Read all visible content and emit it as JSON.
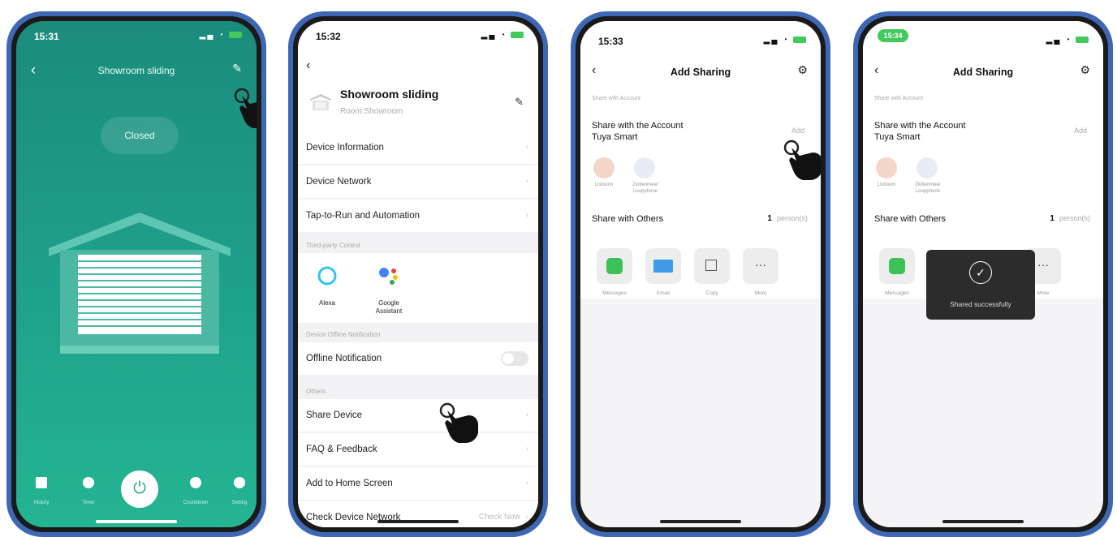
{
  "screen1": {
    "time": "15:31",
    "title": "Showroom sliding",
    "status": "Closed",
    "tabs": [
      "History",
      "Timer",
      "Countdown",
      "Setting"
    ]
  },
  "screen2": {
    "time": "15:32",
    "device_name": "Showroom sliding",
    "room": "Room:Showroom",
    "rows": {
      "device_information": "Device Information",
      "device_network": "Device Network",
      "tap_to_run": "Tap-to-Run and Automation",
      "offline_notification": "Offline Notification",
      "share_device": "Share Device",
      "faq": "FAQ & Feedback",
      "add_home": "Add to Home Screen",
      "check_network": "Check Device Network",
      "check_now": "Check Now"
    },
    "sections": {
      "third_party": "Third-party Control",
      "offline": "Device Offline Notification",
      "others": "Others"
    },
    "services": {
      "alexa": "Alexa",
      "google_1": "Google",
      "google_2": "Assistant"
    }
  },
  "screen3": {
    "time": "15:33",
    "title": "Add Sharing",
    "section_account": "Share with Account",
    "account_line1": "Share with the Account",
    "account_line2": "Tuya Smart",
    "add_label": "Add",
    "avatar1_label": "Lisboom",
    "avatar2_label_1": "Zloltenmeer",
    "avatar2_label_2": "Loopphone",
    "share_others": "Share with Others",
    "count": "1",
    "count_unit": "person(s)",
    "apps": [
      "Messages",
      "Email",
      "Copy",
      "More"
    ]
  },
  "screen4": {
    "time": "15:34",
    "title": "Add Sharing",
    "section_account": "Share with Account",
    "account_line1": "Share with the Account",
    "account_line2": "Tuya Smart",
    "add_label": "Add",
    "avatar1_label": "Lisboom",
    "avatar2_label_1": "Zloltenmeer",
    "avatar2_label_2": "Loopphone",
    "share_others": "Share with Others",
    "count": "1",
    "count_unit": "person(s)",
    "apps_visible": [
      "Messages",
      "More"
    ],
    "toast": "Shared successfully"
  },
  "colors": {
    "teal_dark": "#1b8b7c",
    "teal_light": "#24b592",
    "frame_blue": "#3e68b5",
    "battery_green": "#43c95a"
  }
}
